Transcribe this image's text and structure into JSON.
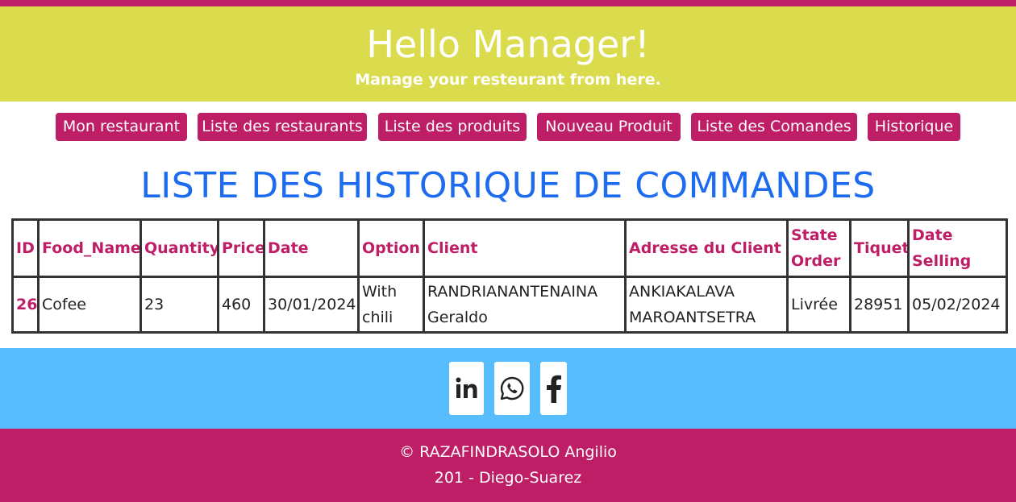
{
  "header": {
    "title": "Hello Manager!",
    "subtitle": "Manage your resteurant from here."
  },
  "nav": {
    "items": [
      {
        "label": "Mon restaurant"
      },
      {
        "label": "Liste des restaurants"
      },
      {
        "label": "Liste des produits"
      },
      {
        "label": "Nouveau Produit"
      },
      {
        "label": "Liste des Comandes"
      },
      {
        "label": "Historique"
      }
    ]
  },
  "page_title": "LISTE DES HISTORIQUE DE COMMANDES",
  "table": {
    "headers": [
      "ID",
      "Food_Name",
      "Quantity",
      "Price",
      "Date",
      "Option",
      "Client",
      "Adresse du Client",
      "State Order",
      "Tiquet",
      "Date Selling"
    ],
    "rows": [
      [
        "26",
        "Cofee",
        "23",
        "460",
        "30/01/2024",
        "With chili",
        "RANDRIANANTENAINA Geraldo",
        "ANKIAKALAVA MAROANTSETRA",
        "Livrée",
        "28951",
        "05/02/2024"
      ]
    ]
  },
  "social": {
    "icons": [
      "linkedin-icon",
      "whatsapp-icon",
      "facebook-icon"
    ]
  },
  "footer": {
    "copyright": "© RAZAFINDRASOLO Angilio",
    "address": "201 - Diego-Suarez"
  },
  "colors": {
    "accent": "#be1e66",
    "hero_bg": "#dbdc4d",
    "title_blue": "#1d6cf0",
    "social_bg": "#58bdfd"
  }
}
